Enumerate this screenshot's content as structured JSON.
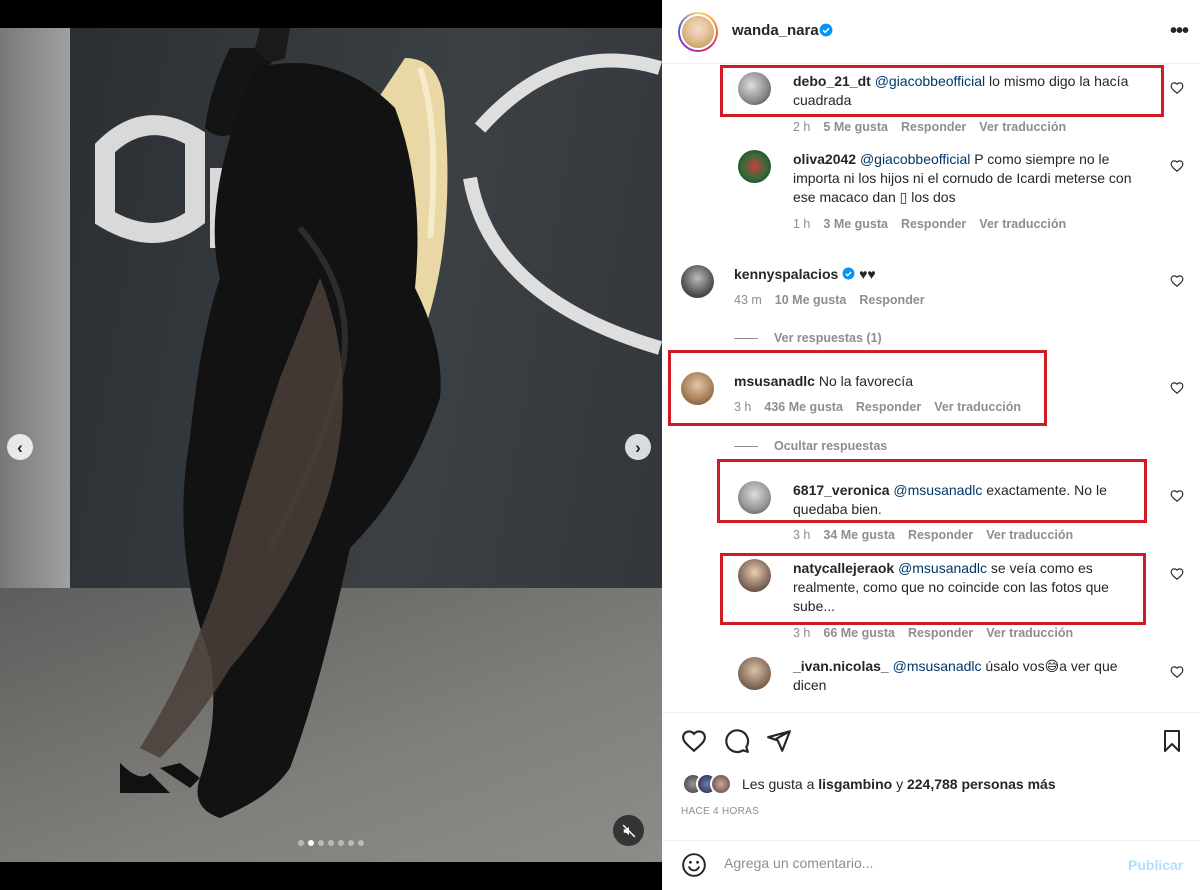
{
  "post": {
    "username": "wanda_nara",
    "more_glyph": "•••",
    "carousel_count": 7,
    "carousel_active": 1,
    "prev_glyph": "‹",
    "next_glyph": "›"
  },
  "comments": {
    "c1": {
      "user": "debo_21_dt",
      "mention": "@giacobbeofficial",
      "text": " lo mismo digo la hacía cuadrada",
      "time": "2 h",
      "likes": "5 Me gusta",
      "reply": "Responder",
      "translate": "Ver traducción"
    },
    "c2": {
      "user": "oliva2042",
      "mention": "@giacobbeofficial",
      "text": " P como siempre no le importa ni los hijos ni el cornudo de Icardi meterse con ese macaco dan ▯ los dos",
      "time": "1 h",
      "likes": "3 Me gusta",
      "reply": "Responder",
      "translate": "Ver traducción"
    },
    "c3": {
      "user": "kennyspalacios",
      "text": "♥♥",
      "time": "43 m",
      "likes": "10 Me gusta",
      "reply": "Responder"
    },
    "c3_view_replies": "Ver respuestas (1)",
    "c4": {
      "user": "msusanadlc",
      "text": "No la favorecía",
      "time": "3 h",
      "likes": "436 Me gusta",
      "reply": "Responder",
      "translate": "Ver traducción"
    },
    "c4_hide_replies": "Ocultar respuestas",
    "c5": {
      "user": "6817_veronica",
      "mention": "@msusanadlc",
      "text": " exactamente. No le quedaba bien.",
      "time": "3 h",
      "likes": "34 Me gusta",
      "reply": "Responder",
      "translate": "Ver traducción"
    },
    "c6": {
      "user": "natycallejeraok",
      "mention": "@msusanadlc",
      "text": " se veía como es realmente, como que no coincide con las fotos que sube...",
      "time": "3 h",
      "likes": "66 Me gusta",
      "reply": "Responder",
      "translate": "Ver traducción"
    },
    "c7": {
      "user": "_ivan.nicolas_",
      "mention": "@msusanadlc",
      "text": " úsalo vos😅a ver que dicen"
    }
  },
  "likes": {
    "prefix": "Les gusta a ",
    "user": "lisgambino",
    "middle": " y ",
    "count": "224,788 personas más"
  },
  "timestamp": "HACE 4 HORAS",
  "composer": {
    "placeholder": "Agrega un comentario...",
    "publish": "Publicar"
  },
  "colors": {
    "highlight_box": "#d11b24",
    "verified": "#0095f6",
    "mention": "#00376b",
    "publish_disabled": "#b2dffc"
  },
  "icons": [
    "chevron-left-icon",
    "chevron-right-icon",
    "muted-speaker-icon",
    "verified-icon",
    "more-icon",
    "heart-icon",
    "comment-icon",
    "share-icon",
    "bookmark-icon",
    "emoji-icon"
  ]
}
